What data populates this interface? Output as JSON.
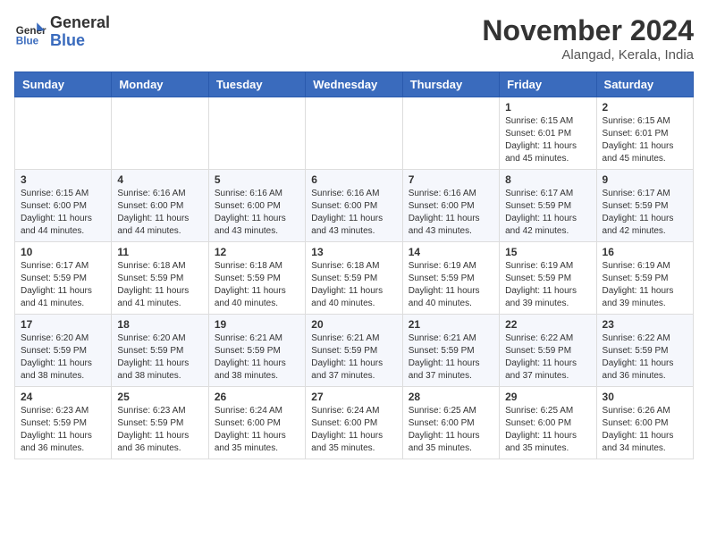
{
  "logo": {
    "line1": "General",
    "line2": "Blue"
  },
  "title": "November 2024",
  "location": "Alangad, Kerala, India",
  "weekdays": [
    "Sunday",
    "Monday",
    "Tuesday",
    "Wednesday",
    "Thursday",
    "Friday",
    "Saturday"
  ],
  "weeks": [
    [
      {
        "day": "",
        "info": ""
      },
      {
        "day": "",
        "info": ""
      },
      {
        "day": "",
        "info": ""
      },
      {
        "day": "",
        "info": ""
      },
      {
        "day": "",
        "info": ""
      },
      {
        "day": "1",
        "info": "Sunrise: 6:15 AM\nSunset: 6:01 PM\nDaylight: 11 hours and 45 minutes."
      },
      {
        "day": "2",
        "info": "Sunrise: 6:15 AM\nSunset: 6:01 PM\nDaylight: 11 hours and 45 minutes."
      }
    ],
    [
      {
        "day": "3",
        "info": "Sunrise: 6:15 AM\nSunset: 6:00 PM\nDaylight: 11 hours and 44 minutes."
      },
      {
        "day": "4",
        "info": "Sunrise: 6:16 AM\nSunset: 6:00 PM\nDaylight: 11 hours and 44 minutes."
      },
      {
        "day": "5",
        "info": "Sunrise: 6:16 AM\nSunset: 6:00 PM\nDaylight: 11 hours and 43 minutes."
      },
      {
        "day": "6",
        "info": "Sunrise: 6:16 AM\nSunset: 6:00 PM\nDaylight: 11 hours and 43 minutes."
      },
      {
        "day": "7",
        "info": "Sunrise: 6:16 AM\nSunset: 6:00 PM\nDaylight: 11 hours and 43 minutes."
      },
      {
        "day": "8",
        "info": "Sunrise: 6:17 AM\nSunset: 5:59 PM\nDaylight: 11 hours and 42 minutes."
      },
      {
        "day": "9",
        "info": "Sunrise: 6:17 AM\nSunset: 5:59 PM\nDaylight: 11 hours and 42 minutes."
      }
    ],
    [
      {
        "day": "10",
        "info": "Sunrise: 6:17 AM\nSunset: 5:59 PM\nDaylight: 11 hours and 41 minutes."
      },
      {
        "day": "11",
        "info": "Sunrise: 6:18 AM\nSunset: 5:59 PM\nDaylight: 11 hours and 41 minutes."
      },
      {
        "day": "12",
        "info": "Sunrise: 6:18 AM\nSunset: 5:59 PM\nDaylight: 11 hours and 40 minutes."
      },
      {
        "day": "13",
        "info": "Sunrise: 6:18 AM\nSunset: 5:59 PM\nDaylight: 11 hours and 40 minutes."
      },
      {
        "day": "14",
        "info": "Sunrise: 6:19 AM\nSunset: 5:59 PM\nDaylight: 11 hours and 40 minutes."
      },
      {
        "day": "15",
        "info": "Sunrise: 6:19 AM\nSunset: 5:59 PM\nDaylight: 11 hours and 39 minutes."
      },
      {
        "day": "16",
        "info": "Sunrise: 6:19 AM\nSunset: 5:59 PM\nDaylight: 11 hours and 39 minutes."
      }
    ],
    [
      {
        "day": "17",
        "info": "Sunrise: 6:20 AM\nSunset: 5:59 PM\nDaylight: 11 hours and 38 minutes."
      },
      {
        "day": "18",
        "info": "Sunrise: 6:20 AM\nSunset: 5:59 PM\nDaylight: 11 hours and 38 minutes."
      },
      {
        "day": "19",
        "info": "Sunrise: 6:21 AM\nSunset: 5:59 PM\nDaylight: 11 hours and 38 minutes."
      },
      {
        "day": "20",
        "info": "Sunrise: 6:21 AM\nSunset: 5:59 PM\nDaylight: 11 hours and 37 minutes."
      },
      {
        "day": "21",
        "info": "Sunrise: 6:21 AM\nSunset: 5:59 PM\nDaylight: 11 hours and 37 minutes."
      },
      {
        "day": "22",
        "info": "Sunrise: 6:22 AM\nSunset: 5:59 PM\nDaylight: 11 hours and 37 minutes."
      },
      {
        "day": "23",
        "info": "Sunrise: 6:22 AM\nSunset: 5:59 PM\nDaylight: 11 hours and 36 minutes."
      }
    ],
    [
      {
        "day": "24",
        "info": "Sunrise: 6:23 AM\nSunset: 5:59 PM\nDaylight: 11 hours and 36 minutes."
      },
      {
        "day": "25",
        "info": "Sunrise: 6:23 AM\nSunset: 5:59 PM\nDaylight: 11 hours and 36 minutes."
      },
      {
        "day": "26",
        "info": "Sunrise: 6:24 AM\nSunset: 6:00 PM\nDaylight: 11 hours and 35 minutes."
      },
      {
        "day": "27",
        "info": "Sunrise: 6:24 AM\nSunset: 6:00 PM\nDaylight: 11 hours and 35 minutes."
      },
      {
        "day": "28",
        "info": "Sunrise: 6:25 AM\nSunset: 6:00 PM\nDaylight: 11 hours and 35 minutes."
      },
      {
        "day": "29",
        "info": "Sunrise: 6:25 AM\nSunset: 6:00 PM\nDaylight: 11 hours and 35 minutes."
      },
      {
        "day": "30",
        "info": "Sunrise: 6:26 AM\nSunset: 6:00 PM\nDaylight: 11 hours and 34 minutes."
      }
    ]
  ]
}
